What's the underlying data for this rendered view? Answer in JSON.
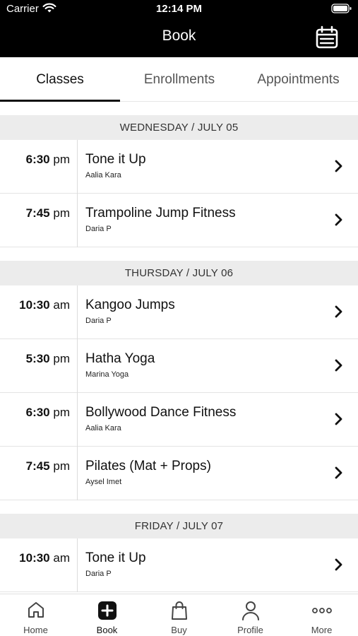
{
  "status_bar": {
    "carrier": "Carrier",
    "time": "12:14 PM"
  },
  "header": {
    "title": "Book",
    "calendar_icon": "calendar-icon"
  },
  "tabs": [
    {
      "label": "Classes",
      "active": true
    },
    {
      "label": "Enrollments",
      "active": false
    },
    {
      "label": "Appointments",
      "active": false
    }
  ],
  "days": [
    {
      "header": "WEDNESDAY / JULY 05",
      "classes": [
        {
          "time": "6:30",
          "period": "pm",
          "name": "Tone it Up",
          "instructor": "Aalia Kara"
        },
        {
          "time": "7:45",
          "period": "pm",
          "name": "Trampoline Jump Fitness",
          "instructor": "Daria P"
        }
      ]
    },
    {
      "header": "THURSDAY / JULY 06",
      "classes": [
        {
          "time": "10:30",
          "period": "am",
          "name": "Kangoo Jumps",
          "instructor": "Daria P"
        },
        {
          "time": "5:30",
          "period": "pm",
          "name": "Hatha Yoga",
          "instructor": "Marina Yoga"
        },
        {
          "time": "6:30",
          "period": "pm",
          "name": "Bollywood Dance Fitness",
          "instructor": "Aalia Kara"
        },
        {
          "time": "7:45",
          "period": "pm",
          "name": "Pilates (Mat + Props)",
          "instructor": "Aysel Imet"
        }
      ]
    },
    {
      "header": "FRIDAY / JULY 07",
      "classes": [
        {
          "time": "10:30",
          "period": "am",
          "name": "Tone it Up",
          "instructor": "Daria P"
        }
      ]
    }
  ],
  "bottom_nav": [
    {
      "label": "Home",
      "icon": "home-icon",
      "active": false
    },
    {
      "label": "Book",
      "icon": "plus-square-icon",
      "active": true
    },
    {
      "label": "Buy",
      "icon": "shopping-bag-icon",
      "active": false
    },
    {
      "label": "Profile",
      "icon": "profile-icon",
      "active": false
    },
    {
      "label": "More",
      "icon": "more-dots-icon",
      "active": false
    }
  ]
}
